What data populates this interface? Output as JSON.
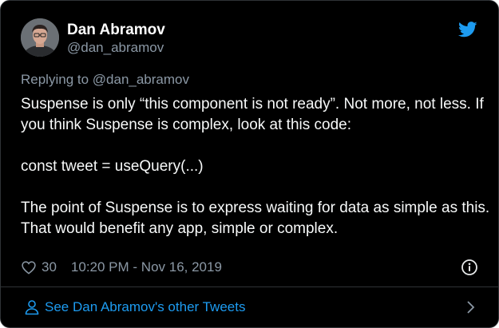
{
  "author": {
    "display_name": "Dan Abramov",
    "handle": "@dan_abramov"
  },
  "brand_icon": "twitter-bird-icon",
  "replying": {
    "prefix": "Replying to ",
    "handle": "@dan_abramov"
  },
  "tweet": {
    "paragraph_1": "Suspense is only “this component is not ready”. Not more, not less. If you think Suspense is complex, look at this code:",
    "paragraph_2": "const tweet = useQuery(...)",
    "paragraph_3": "The point of Suspense is to express waiting for data as simple as this. That would benefit any app, simple or complex."
  },
  "meta": {
    "like_count": "30",
    "timestamp": "10:20 PM - Nov 16, 2019"
  },
  "footer": {
    "label": "See Dan Abramov's other Tweets"
  },
  "colors": {
    "background": "#000000",
    "text": "#e7e9ea",
    "secondary": "#8b98a5",
    "accent": "#1d9bf0",
    "border": "#2f3336"
  }
}
